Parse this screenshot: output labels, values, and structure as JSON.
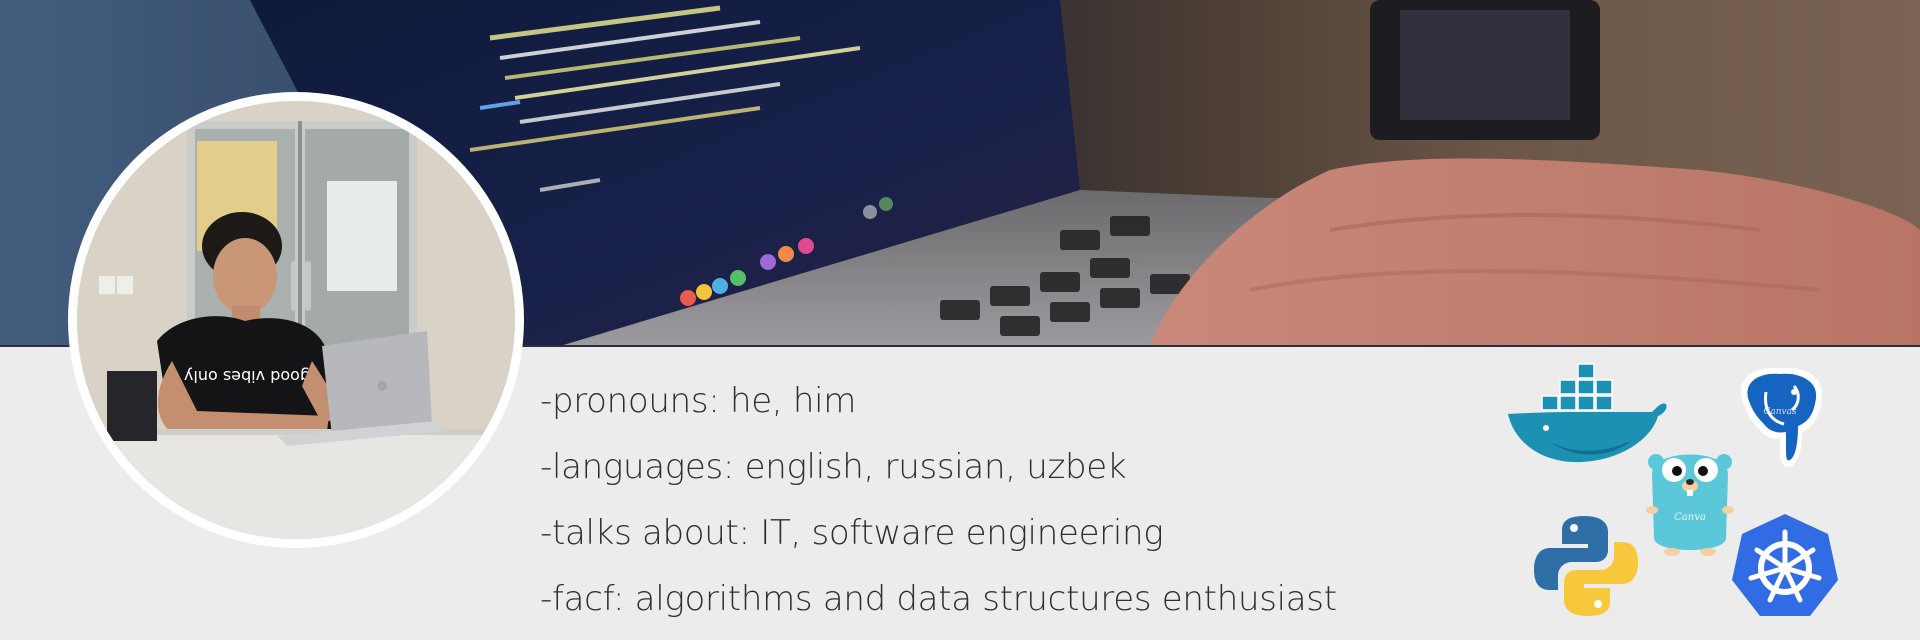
{
  "hero": {
    "image": "laptop-with-code-photo"
  },
  "profile": {
    "avatar": "person-at-laptop-photo",
    "shirt_text": "good vibes only"
  },
  "bio": {
    "lines": [
      "-pronouns: he, him",
      "-languages: english, russian, uzbek",
      "-talks about: IT, software engineering",
      "-facf: algorithms and data structures enthusiast"
    ]
  },
  "tech_logos": {
    "items": [
      {
        "name": "docker",
        "icon": "docker-whale-icon",
        "color": "#1d91b4"
      },
      {
        "name": "postgresql",
        "icon": "postgresql-elephant-icon",
        "color": "#1565c0",
        "caption": "Canvas"
      },
      {
        "name": "go",
        "icon": "go-gopher-icon",
        "color": "#5ac8d8",
        "caption": "Canva"
      },
      {
        "name": "python",
        "icon": "python-icon",
        "colors": [
          "#2f6fa8",
          "#f7c83c"
        ]
      },
      {
        "name": "kubernetes",
        "icon": "kubernetes-wheel-icon",
        "color": "#326ce5"
      }
    ]
  },
  "colors": {
    "background": "#ececec",
    "text": "#2e2e2e",
    "avatar_ring": "#ffffff"
  }
}
